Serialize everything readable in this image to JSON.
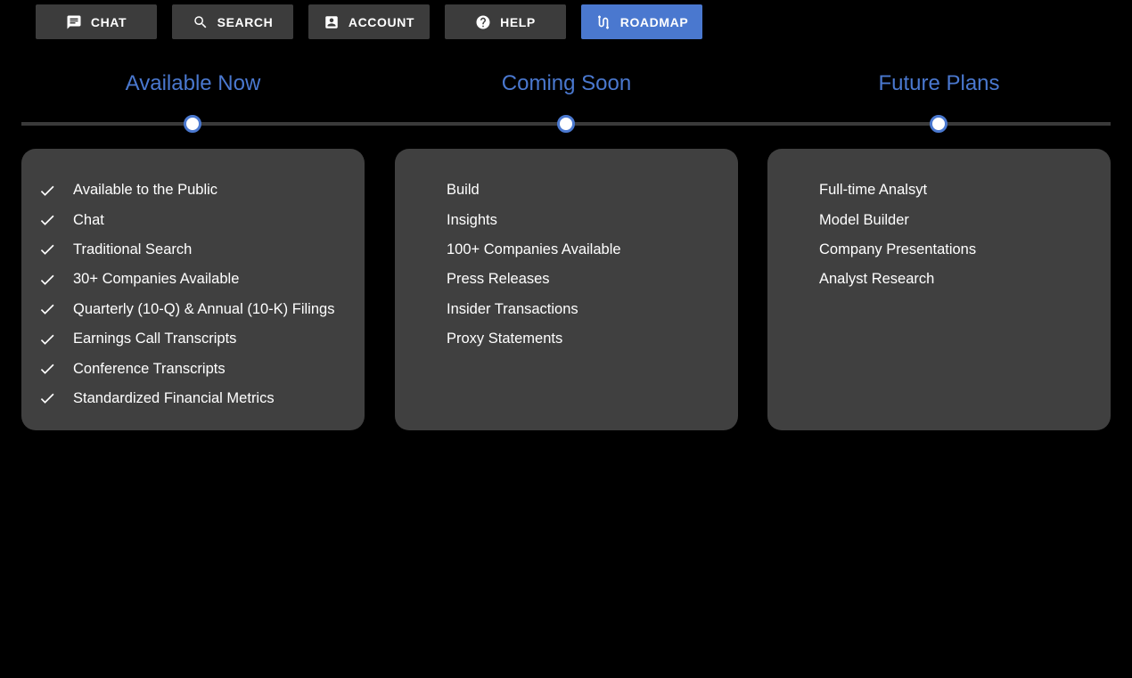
{
  "nav": {
    "items": [
      {
        "label": "CHAT",
        "icon": "chat-icon",
        "active": false
      },
      {
        "label": "SEARCH",
        "icon": "search-icon",
        "active": false
      },
      {
        "label": "ACCOUNT",
        "icon": "account-icon",
        "active": false
      },
      {
        "label": "HELP",
        "icon": "help-icon",
        "active": false
      },
      {
        "label": "ROADMAP",
        "icon": "roadmap-icon",
        "active": true
      }
    ]
  },
  "colors": {
    "accent": "#4a78cf",
    "background": "#000000",
    "card": "#404040",
    "button": "#3c3c3c",
    "timeline": "#3a3a3a"
  },
  "roadmap": {
    "phases": [
      {
        "title": "Available Now",
        "checked": true,
        "items": [
          "Available to the Public",
          "Chat",
          "Traditional Search",
          "30+ Companies Available",
          "Quarterly (10-Q) & Annual (10-K) Filings",
          "Earnings Call Transcripts",
          "Conference Transcripts",
          "Standardized Financial Metrics"
        ]
      },
      {
        "title": "Coming Soon",
        "checked": false,
        "items": [
          "Build",
          "Insights",
          "100+ Companies Available",
          "Press Releases",
          "Insider Transactions",
          "Proxy Statements"
        ]
      },
      {
        "title": "Future Plans",
        "checked": false,
        "items": [
          "Full-time Analsyt",
          "Model Builder",
          "Company Presentations",
          "Analyst Research"
        ]
      }
    ]
  }
}
